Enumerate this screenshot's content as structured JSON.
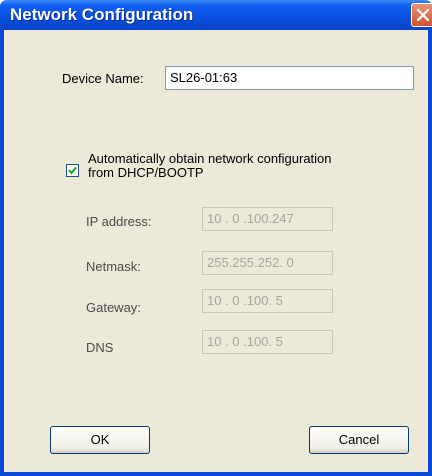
{
  "window": {
    "title": "Network Configuration"
  },
  "device": {
    "label": "Device Name:",
    "value": "SL26-01:63"
  },
  "dhcp": {
    "checked": true,
    "label_line1": "Automatically obtain network configuration",
    "label_line2": "from DHCP/BOOTP"
  },
  "network": {
    "ip_label": "IP address:",
    "ip_value": "10 . 0 .100.247",
    "netmask_label": "Netmask:",
    "netmask_value": "255.255.252. 0",
    "gateway_label": "Gateway:",
    "gateway_value": "10 . 0 .100. 5",
    "dns_label": "DNS",
    "dns_value": "10 . 0 .100. 5"
  },
  "buttons": {
    "ok": "OK",
    "cancel": "Cancel"
  },
  "colors": {
    "titlebar": "#0a4fdf",
    "client": "#ece9d8",
    "close": "#d2512d"
  }
}
